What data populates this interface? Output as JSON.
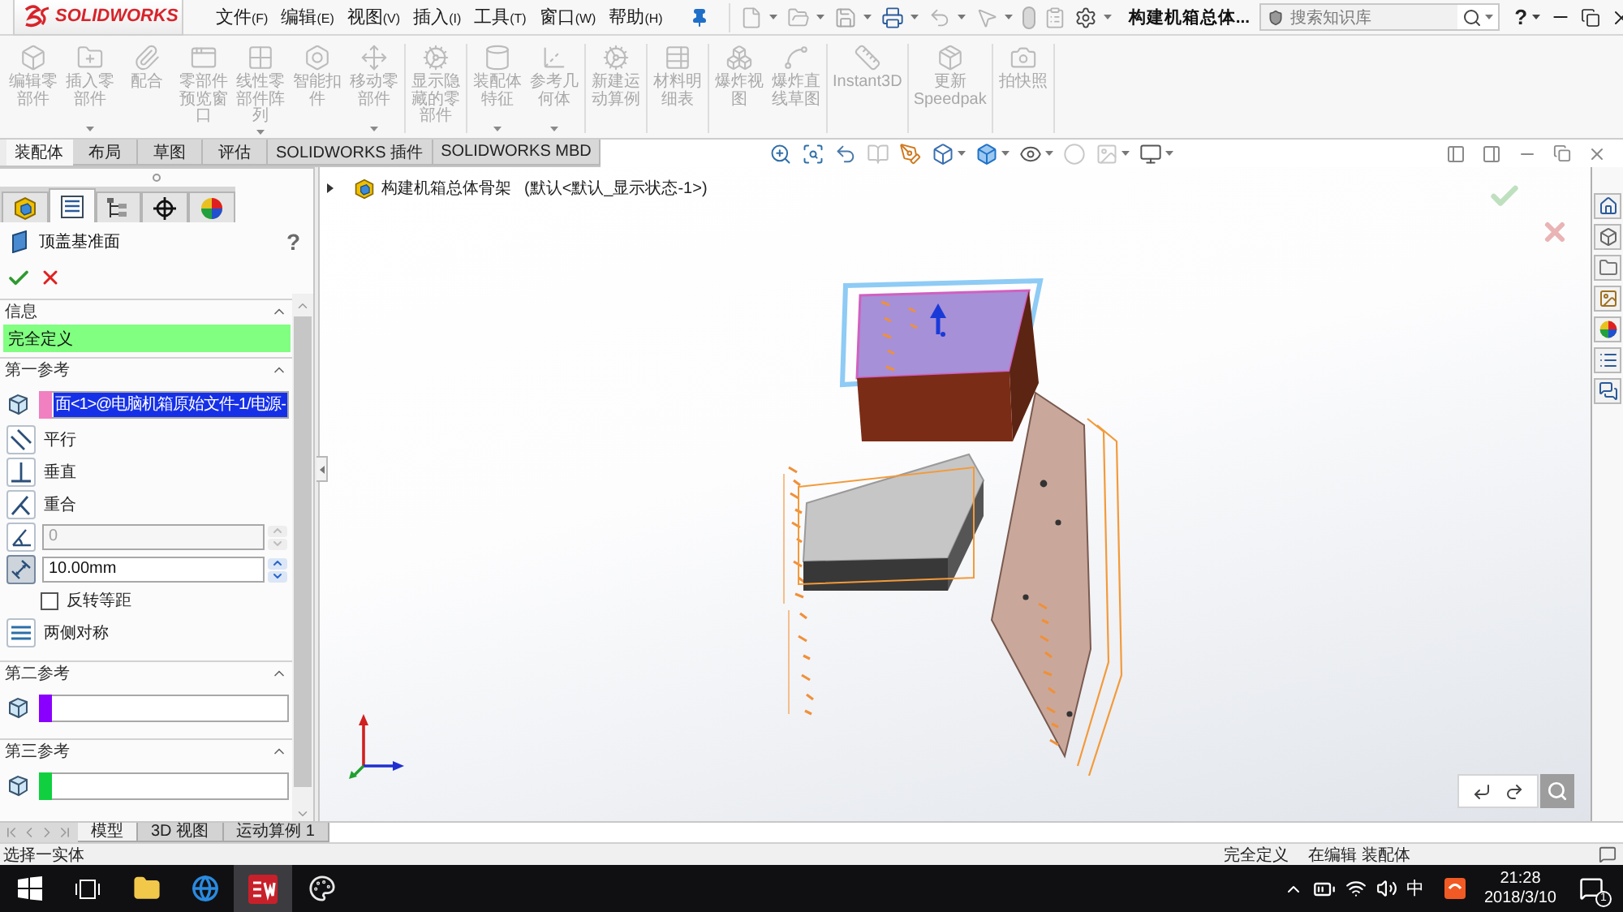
{
  "app": {
    "logo": "SOLIDWORKS"
  },
  "menu": [
    {
      "label": "文件",
      "key": "(F)"
    },
    {
      "label": "编辑",
      "key": "(E)"
    },
    {
      "label": "视图",
      "key": "(V)"
    },
    {
      "label": "插入",
      "key": "(I)"
    },
    {
      "label": "工具",
      "key": "(T)"
    },
    {
      "label": "窗口",
      "key": "(W)"
    },
    {
      "label": "帮助",
      "key": "(H)"
    }
  ],
  "document_title": "构建机箱总体...",
  "search": {
    "placeholder": "搜索知识库"
  },
  "help": "?",
  "ribbon": {
    "groups": [
      [
        {
          "kind": "edit_part",
          "label": "编辑零部件",
          "disabled": true,
          "dropdown": false
        },
        {
          "kind": "insert_part",
          "label": "插入零部件",
          "disabled": true,
          "dropdown": true
        },
        {
          "kind": "mate",
          "label": "配合",
          "disabled": true,
          "dropdown": false
        },
        {
          "kind": "preview",
          "label": "零部件预览窗口",
          "disabled": true,
          "dropdown": false
        },
        {
          "kind": "pattern",
          "label": "线性零部件阵列",
          "disabled": true,
          "dropdown": true
        },
        {
          "kind": "fastener",
          "label": "智能扣件",
          "disabled": true,
          "dropdown": false
        },
        {
          "kind": "move",
          "label": "移动零部件",
          "disabled": true,
          "dropdown": true
        }
      ],
      [
        {
          "kind": "show_hidden",
          "label": "显示隐藏的零部件",
          "disabled": true,
          "dropdown": false
        }
      ],
      [
        {
          "kind": "feature",
          "label": "装配体特征",
          "disabled": true,
          "dropdown": true
        },
        {
          "kind": "reference",
          "label": "参考几何体",
          "disabled": true,
          "dropdown": true
        }
      ],
      [
        {
          "kind": "motion",
          "label": "新建运动算例",
          "disabled": true,
          "dropdown": false
        }
      ],
      [
        {
          "kind": "bom",
          "label": "材料明细表",
          "disabled": true,
          "dropdown": false
        }
      ],
      [
        {
          "kind": "explode",
          "label": "爆炸视图",
          "disabled": true,
          "dropdown": false
        },
        {
          "kind": "explode_line",
          "label": "爆炸直线草图",
          "disabled": true,
          "dropdown": false
        }
      ],
      [
        {
          "kind": "instant3d",
          "label": "Instant3D",
          "disabled": true,
          "dropdown": false
        }
      ],
      [
        {
          "kind": "speedpak",
          "label": "更新 Speedpak",
          "disabled": true,
          "dropdown": false
        }
      ],
      [
        {
          "kind": "snapshot",
          "label": "拍快照",
          "disabled": true,
          "dropdown": false
        }
      ]
    ]
  },
  "command_tabs": [
    {
      "label": "装配体",
      "selected": true
    },
    {
      "label": "布局",
      "selected": false
    },
    {
      "label": "草图",
      "selected": false
    },
    {
      "label": "评估",
      "selected": false
    },
    {
      "label": "SOLIDWORKS 插件",
      "selected": false
    },
    {
      "label": "SOLIDWORKS MBD",
      "selected": false
    }
  ],
  "property_manager": {
    "tabs": [
      {
        "kind": "feature_tree",
        "selected": false
      },
      {
        "kind": "properties",
        "selected": true
      },
      {
        "kind": "configurations",
        "selected": false
      },
      {
        "kind": "dimxpert",
        "selected": false
      },
      {
        "kind": "display",
        "selected": false
      }
    ],
    "title": "顶盖基准面",
    "help": "?",
    "sections": [
      {
        "kind": "message",
        "title": "信息",
        "expanded": true,
        "message": "完全定义"
      },
      {
        "kind": "reference",
        "title": "第一参考",
        "expanded": true,
        "reference": {
          "value": "面<1>@电脑机箱原始文件-1/电源-",
          "color": "#f080c0",
          "selected": true
        },
        "options": [
          {
            "kind": "parallel",
            "label": "平行",
            "selected": false
          },
          {
            "kind": "perpendicular",
            "label": "垂直",
            "selected": false
          },
          {
            "kind": "coincident",
            "label": "重合",
            "selected": false
          },
          {
            "kind": "angle",
            "value": "0",
            "disabled": true,
            "selected": false
          },
          {
            "kind": "distance",
            "value": "10.00mm",
            "disabled": false,
            "selected": true
          },
          {
            "kind": "flip",
            "label": "反转等距",
            "checked": false
          },
          {
            "kind": "symmetric",
            "label": "两侧对称",
            "selected": false
          }
        ]
      },
      {
        "kind": "reference",
        "title": "第二参考",
        "expanded": true,
        "reference": {
          "color": "#8a00ff"
        }
      },
      {
        "kind": "reference",
        "title": "第三参考",
        "expanded": true,
        "reference": {
          "color": "#10d040"
        }
      }
    ]
  },
  "viewport": {
    "tree_item": {
      "name": "构建机箱总体骨架",
      "configuration": "(默认<默认_显示状态-1>)",
      "expanded": false
    }
  },
  "model_tabs": [
    {
      "label": "模型",
      "selected": true
    },
    {
      "label": "3D 视图",
      "selected": false
    },
    {
      "label": "运动算例 1",
      "selected": false
    }
  ],
  "status_bar": {
    "prompt": "选择一实体",
    "state": "完全定义",
    "mode": "在编辑 装配体"
  },
  "taskbar": {
    "apps": [
      {
        "kind": "explorer",
        "selected": false
      },
      {
        "kind": "browser",
        "selected": false
      },
      {
        "kind": "cad",
        "selected": true
      },
      {
        "kind": "paint",
        "selected": false
      }
    ],
    "ime": "中",
    "time": "21:28",
    "date": "2018/3/10",
    "notifications": "1"
  }
}
